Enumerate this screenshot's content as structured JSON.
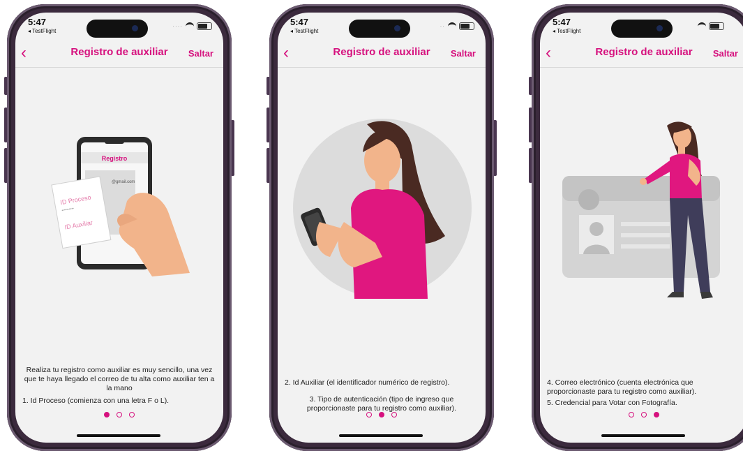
{
  "screens": [
    {
      "status": {
        "time": "5:47",
        "back_app": "◂ TestFlight"
      },
      "nav": {
        "back": "‹",
        "title": "Registro de auxiliar",
        "skip": "Saltar"
      },
      "illustration": {
        "type": "phone-with-card",
        "screen_heading": "Registro",
        "email_fragment": "@gmail.com",
        "card_line1": "ID Proceso",
        "card_line2": "ID Auxiliar",
        "card_mask": "••••••••••"
      },
      "paragraphs": [
        "Realiza tu registro como auxiliar es muy sencillo, una vez que te haya llegado el correo de tu alta como auxiliar ten a la mano",
        "1. Id Proceso (comienza con una letra F o L)."
      ],
      "active_dot": 0
    },
    {
      "status": {
        "time": "5:47",
        "back_app": "◂ TestFlight"
      },
      "nav": {
        "back": "‹",
        "title": "Registro de auxiliar",
        "skip": "Saltar"
      },
      "illustration": {
        "type": "woman-with-phone"
      },
      "paragraphs": [
        "2. Id Auxiliar (el identificador numérico de registro).",
        "3. Tipo de autenticación (tipo de ingreso que proporcionaste para tu registro como auxiliar)."
      ],
      "active_dot": 1
    },
    {
      "status": {
        "time": "5:47",
        "back_app": "◂ TestFlight"
      },
      "nav": {
        "back": "‹",
        "title": "Registro de auxiliar",
        "skip": "Saltar"
      },
      "illustration": {
        "type": "woman-with-id-card"
      },
      "paragraphs": [
        "4. Correo electrónico (cuenta electrónica que proporcionaste para tu registro como auxiliar).",
        "5. Credencial para Votar con Fotografía."
      ],
      "active_dot": 2
    }
  ],
  "colors": {
    "accent": "#d6117e",
    "background": "#f2f2f2",
    "frame": "#3b2a3d"
  }
}
